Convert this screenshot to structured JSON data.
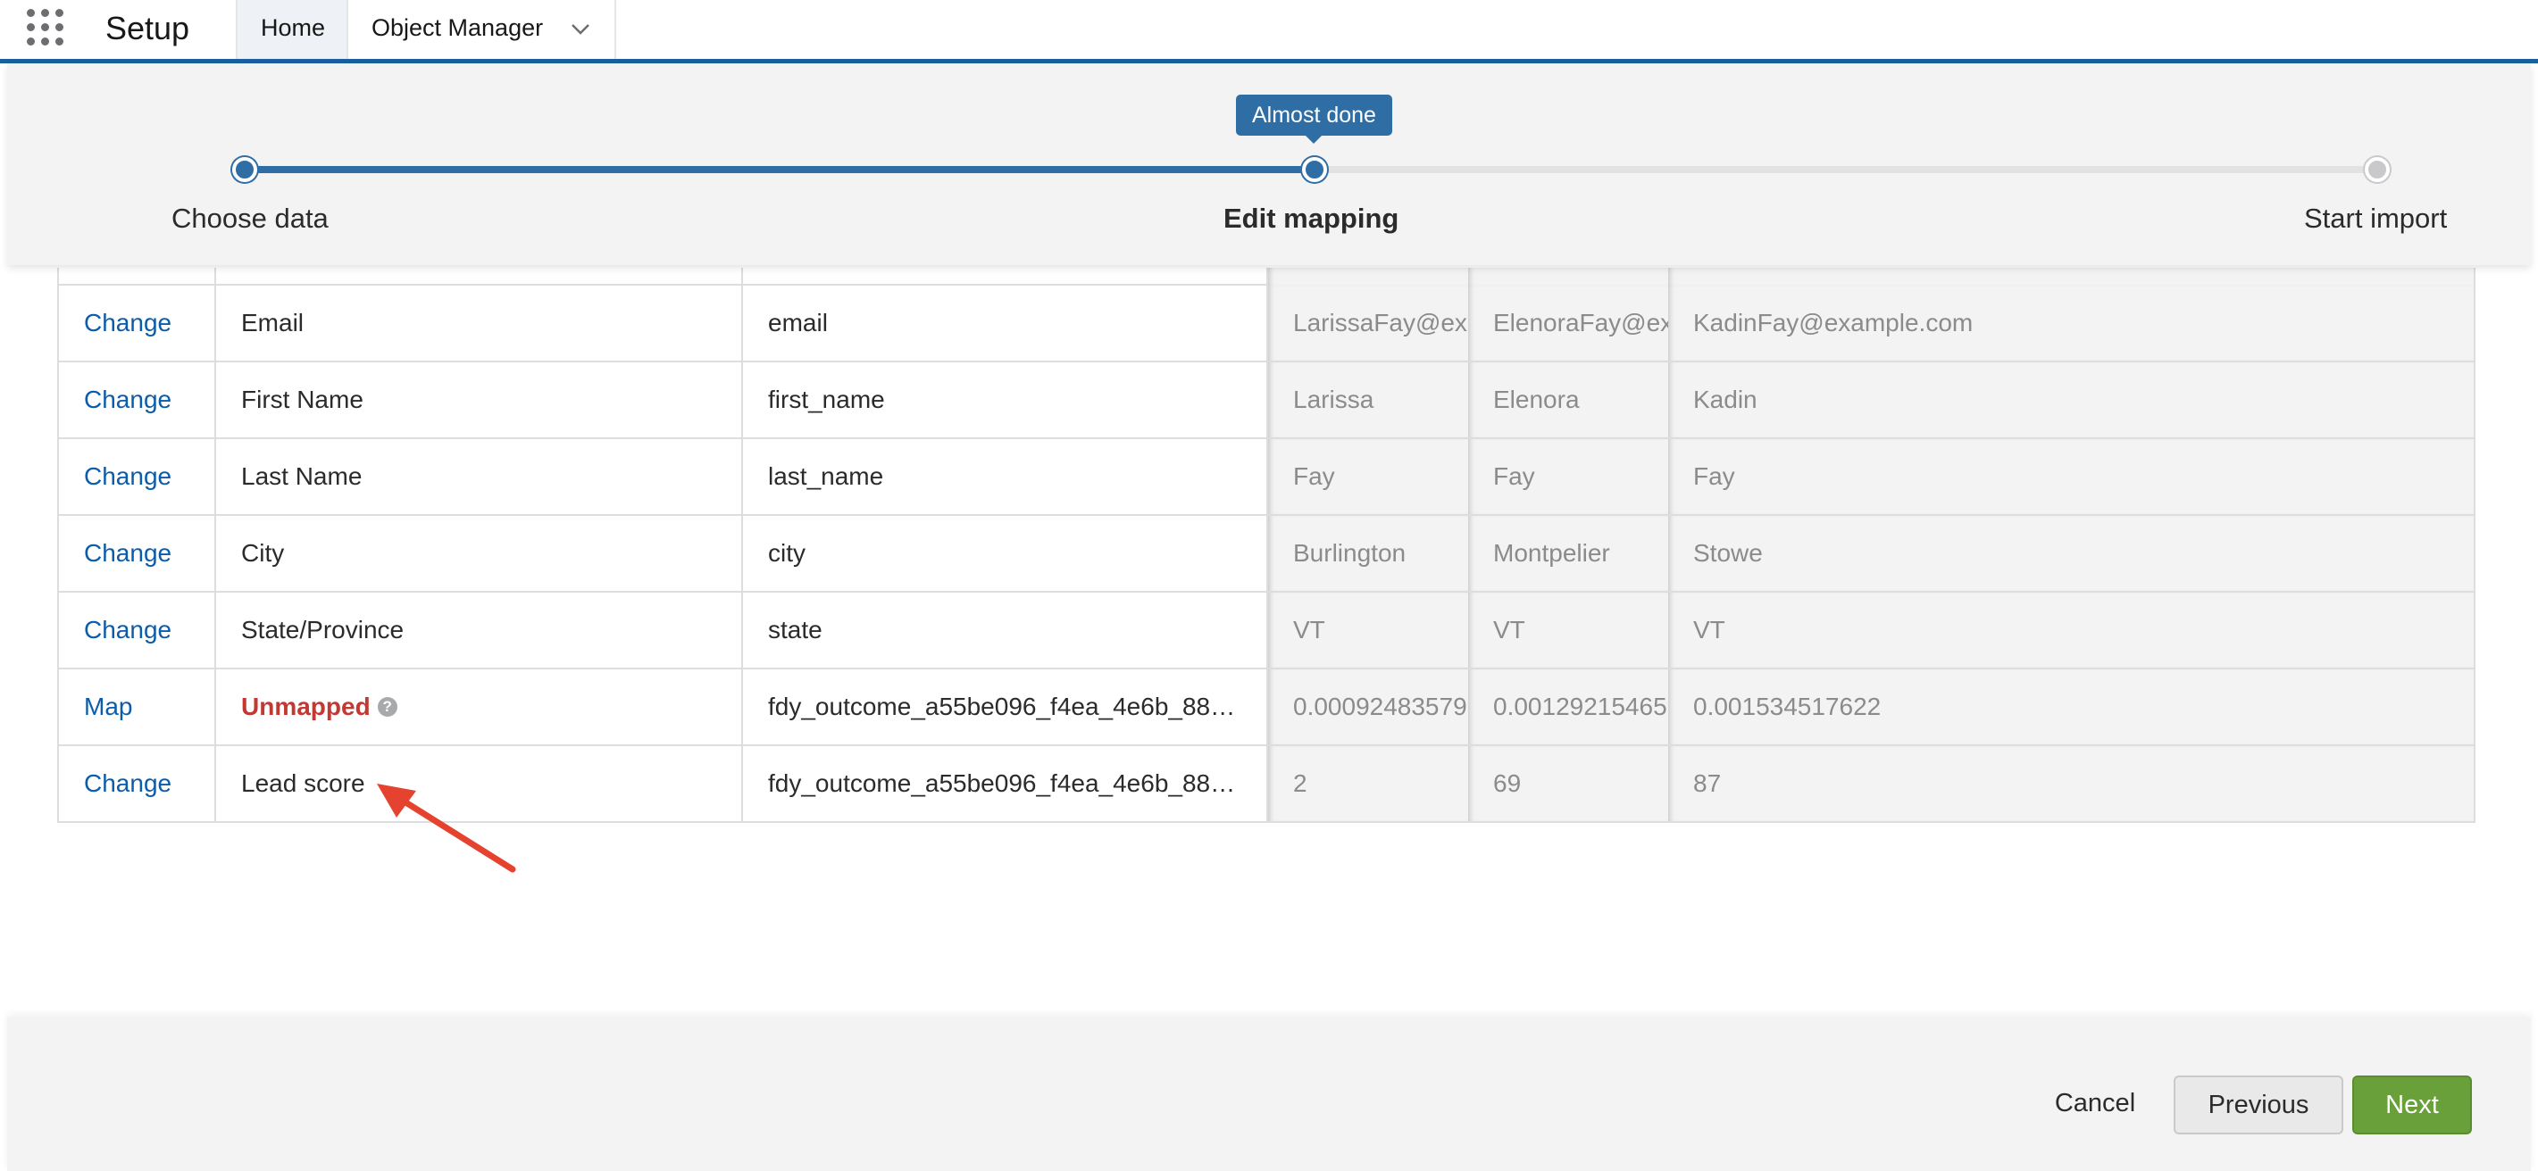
{
  "app": {
    "title": "Setup"
  },
  "tabs": [
    {
      "label": "Home"
    },
    {
      "label": "Object Manager"
    }
  ],
  "wizard": {
    "tooltip": "Almost done",
    "steps": [
      {
        "label": "Choose data"
      },
      {
        "label": "Edit mapping"
      },
      {
        "label": "Start import"
      }
    ]
  },
  "rows": [
    {
      "action": "Change",
      "field": "Email",
      "column": "email",
      "samples": [
        "LarissaFay@ex",
        "ElenoraFay@ex",
        "KadinFay@example.com"
      ]
    },
    {
      "action": "Change",
      "field": "First Name",
      "column": "first_name",
      "samples": [
        "Larissa",
        "Elenora",
        "Kadin"
      ]
    },
    {
      "action": "Change",
      "field": "Last Name",
      "column": "last_name",
      "samples": [
        "Fay",
        "Fay",
        "Fay"
      ]
    },
    {
      "action": "Change",
      "field": "City",
      "column": "city",
      "samples": [
        "Burlington",
        "Montpelier",
        "Stowe"
      ]
    },
    {
      "action": "Change",
      "field": "State/Province",
      "column": "state",
      "samples": [
        "VT",
        "VT",
        "VT"
      ]
    },
    {
      "action": "Map",
      "field": "Unmapped",
      "column": "fdy_outcome_a55be096_f4ea_4e6b_88…",
      "samples": [
        "0.00092483579",
        "0.00129215465",
        "0.001534517622"
      ]
    },
    {
      "action": "Change",
      "field": "Lead score",
      "column": "fdy_outcome_a55be096_f4ea_4e6b_88…",
      "samples": [
        "2",
        "69",
        "87"
      ]
    }
  ],
  "footer": {
    "cancel": "Cancel",
    "previous": "Previous",
    "next": "Next"
  },
  "colors": {
    "brand_blue": "#2f6ea5",
    "link_blue": "#0b5cab",
    "unmapped_red": "#c23934",
    "next_green": "#6aa03a",
    "arrow_red": "#e5432f"
  }
}
